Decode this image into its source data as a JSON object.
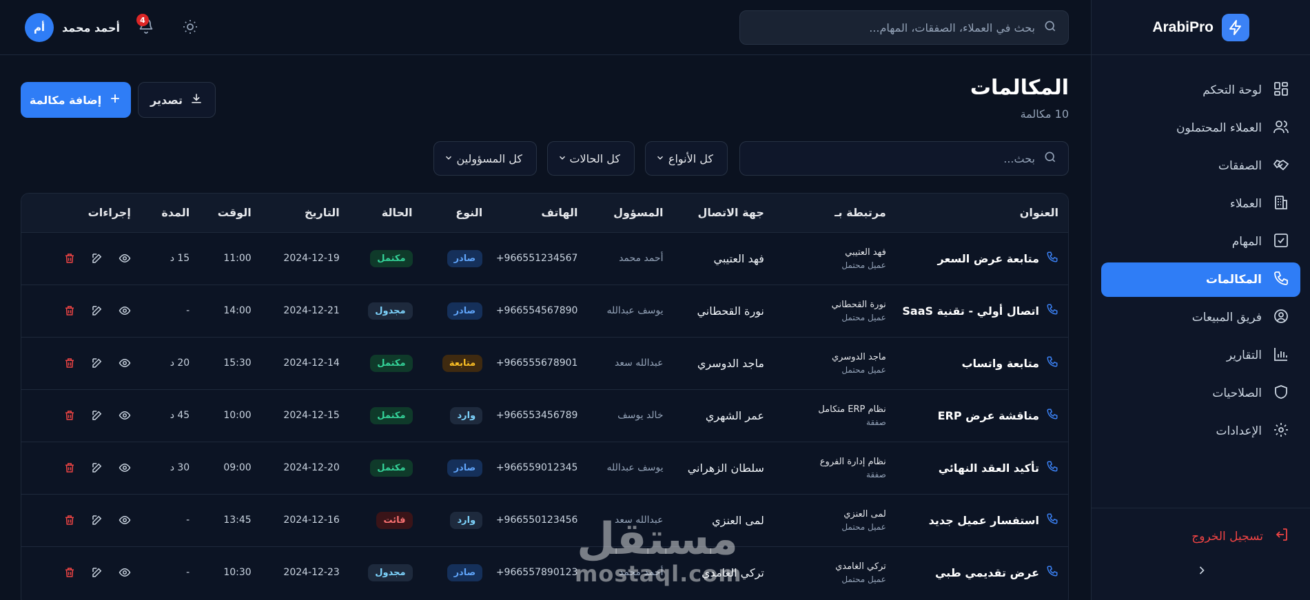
{
  "brand": {
    "name": "ArabiPro",
    "icon": "lightning-icon"
  },
  "sidebar": {
    "items": [
      {
        "label": "لوحة التحكم",
        "icon": "dashboard-icon",
        "active": false
      },
      {
        "label": "العملاء المحتملون",
        "icon": "users-icon",
        "active": false
      },
      {
        "label": "الصفقات",
        "icon": "handshake-icon",
        "active": false
      },
      {
        "label": "العملاء",
        "icon": "building-icon",
        "active": false
      },
      {
        "label": "المهام",
        "icon": "checkbox-icon",
        "active": false
      },
      {
        "label": "المكالمات",
        "icon": "phone-icon",
        "active": true
      },
      {
        "label": "فريق المبيعات",
        "icon": "user-circle-icon",
        "active": false
      },
      {
        "label": "التقارير",
        "icon": "bar-chart-icon",
        "active": false
      },
      {
        "label": "الصلاحيات",
        "icon": "shield-icon",
        "active": false
      },
      {
        "label": "الإعدادات",
        "icon": "gear-icon",
        "active": false
      }
    ],
    "logout_label": "تسجيل الخروج"
  },
  "header": {
    "search_placeholder": "بحث في العملاء، الصفقات، المهام...",
    "user_name": "أحمد محمد",
    "user_initials": "أم",
    "notification_count": "4"
  },
  "page": {
    "title": "المكالمات",
    "subtitle": "10 مكالمة",
    "add_label": "إضافة مكالمة",
    "export_label": "تصدير"
  },
  "filters": {
    "search_placeholder": "بحث...",
    "types_value": "كل الأنواع",
    "status_value": "كل الحالات",
    "owner_value": "كل المسؤولين"
  },
  "table": {
    "headers": [
      "العنوان",
      "مرتبطة بـ",
      "جهة الاتصال",
      "المسؤول",
      "الهاتف",
      "النوع",
      "الحالة",
      "التاريخ",
      "الوقت",
      "المدة",
      "إجراءات"
    ],
    "rows": [
      {
        "title": "متابعة عرض السعر",
        "rel_name": "فهد العتيبي",
        "rel_type": "عميل محتمل",
        "contact": "فهد العتيبي",
        "owner": "أحمد محمد",
        "phone": "+966551234567",
        "type": "صادر",
        "status": "مكتمل",
        "date": "2024-12-19",
        "time": "11:00",
        "duration": "15 د"
      },
      {
        "title": "اتصال أولي - تقنية SaaS",
        "rel_name": "نورة القحطاني",
        "rel_type": "عميل محتمل",
        "contact": "نورة القحطاني",
        "owner": "يوسف عبدالله",
        "phone": "+966554567890",
        "type": "صادر",
        "status": "مجدول",
        "date": "2024-12-21",
        "time": "14:00",
        "duration": "-"
      },
      {
        "title": "متابعة واتساب",
        "rel_name": "ماجد الدوسري",
        "rel_type": "عميل محتمل",
        "contact": "ماجد الدوسري",
        "owner": "عبدالله سعد",
        "phone": "+966555678901",
        "type": "متابعة",
        "status": "مكتمل",
        "date": "2024-12-14",
        "time": "15:30",
        "duration": "20 د"
      },
      {
        "title": "مناقشة عرض ERP",
        "rel_name": "نظام ERP متكامل",
        "rel_type": "صفقة",
        "contact": "عمر الشهري",
        "owner": "خالد يوسف",
        "phone": "+966553456789",
        "type": "وارد",
        "status": "مكتمل",
        "date": "2024-12-15",
        "time": "10:00",
        "duration": "45 د"
      },
      {
        "title": "تأكيد العقد النهائي",
        "rel_name": "نظام إدارة الفروع",
        "rel_type": "صفقة",
        "contact": "سلطان الزهراني",
        "owner": "يوسف عبدالله",
        "phone": "+966559012345",
        "type": "صادر",
        "status": "مكتمل",
        "date": "2024-12-20",
        "time": "09:00",
        "duration": "30 د"
      },
      {
        "title": "استفسار عميل جديد",
        "rel_name": "لمى العنزي",
        "rel_type": "عميل محتمل",
        "contact": "لمى العنزي",
        "owner": "عبدالله سعد",
        "phone": "+966550123456",
        "type": "وارد",
        "status": "فائت",
        "date": "2024-12-16",
        "time": "13:45",
        "duration": "-"
      },
      {
        "title": "عرض تقديمي طبي",
        "rel_name": "تركي الغامدي",
        "rel_type": "عميل محتمل",
        "contact": "تركي الغامدي",
        "owner": "أحمد محمد",
        "phone": "+966557890123",
        "type": "صادر",
        "status": "مجدول",
        "date": "2024-12-23",
        "time": "10:30",
        "duration": "-"
      }
    ]
  },
  "colors": {
    "accent": "#2f7df6",
    "background": "#0b1220",
    "danger": "#ef4444"
  },
  "watermark": {
    "arabic": "مستقل",
    "latin": "mostaql.com"
  }
}
